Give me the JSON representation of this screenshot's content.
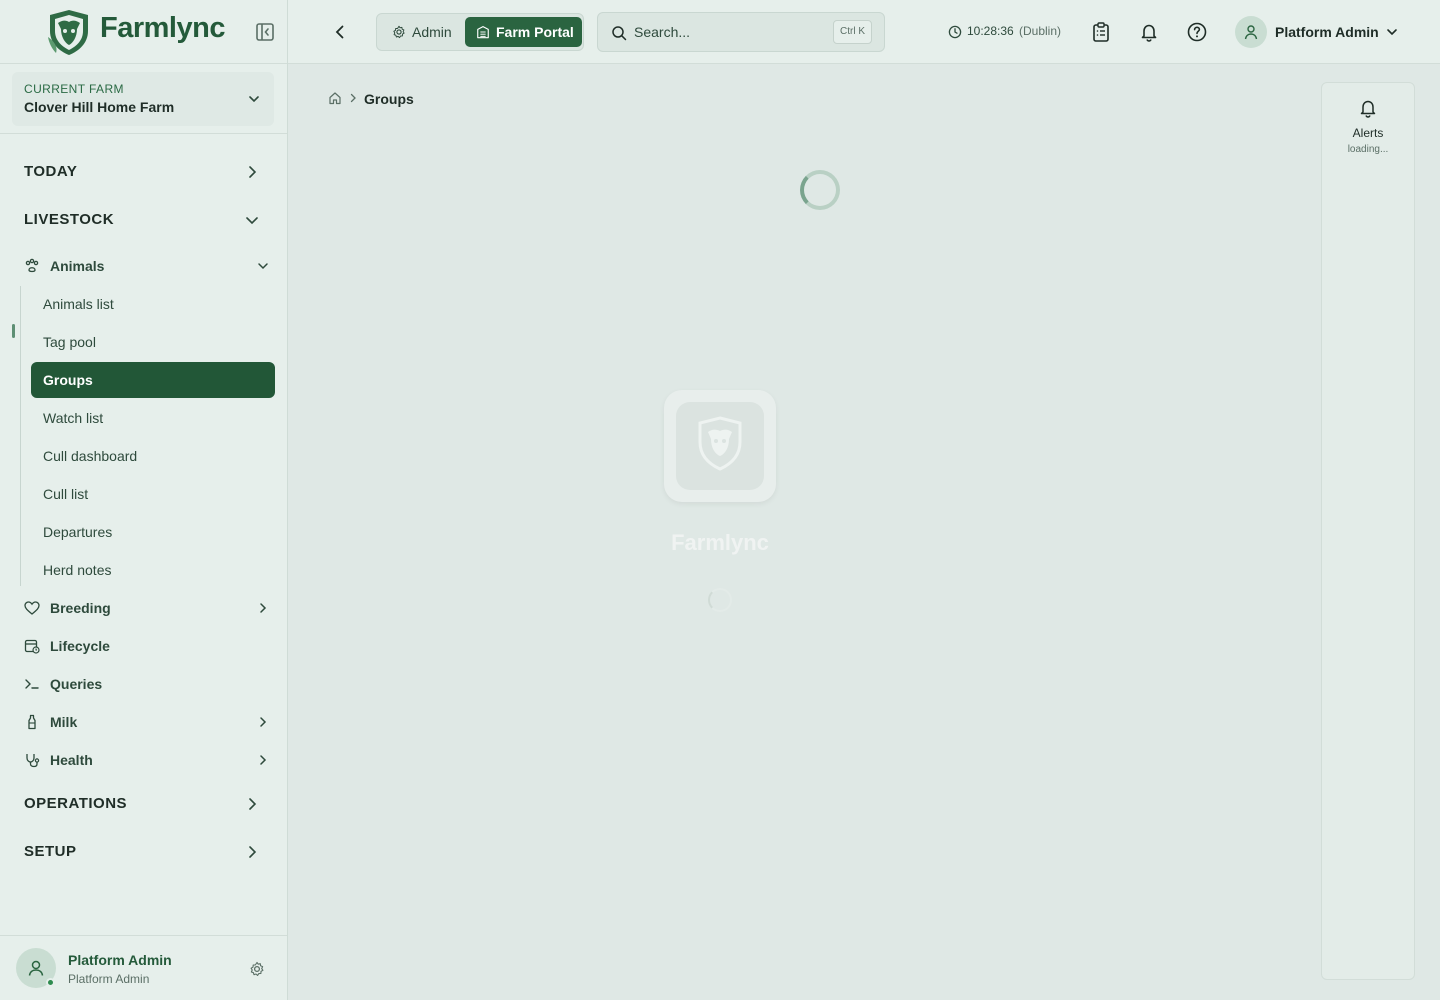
{
  "brand": {
    "name": "Farmlync"
  },
  "farm": {
    "caption": "CURRENT FARM",
    "name": "Clover Hill Home Farm"
  },
  "sidebar": {
    "sections": {
      "today": "TODAY",
      "livestock": "LIVESTOCK",
      "operations": "OPERATIONS",
      "setup": "SETUP"
    },
    "animals": {
      "label": "Animals",
      "items": [
        "Animals list",
        "Tag pool",
        "Groups",
        "Watch list",
        "Cull dashboard",
        "Cull list",
        "Departures",
        "Herd notes"
      ],
      "active": "Groups"
    },
    "modules": [
      "Breeding",
      "Lifecycle",
      "Queries",
      "Milk",
      "Health"
    ]
  },
  "profile": {
    "name": "Platform Admin",
    "role": "Platform Admin"
  },
  "topbar": {
    "admin_label": "Admin",
    "portal_label": "Farm Portal",
    "search_placeholder": "Search...",
    "search_shortcut": "Ctrl K",
    "clock_time": "10:28:36",
    "clock_zone": "(Dublin)",
    "user_name": "Platform Admin"
  },
  "breadcrumb": {
    "current": "Groups"
  },
  "splash": {
    "name": "Farmlync"
  },
  "alerts": {
    "label": "Alerts",
    "status": "loading..."
  },
  "colors": {
    "brand": "#245a3a",
    "active": "#225737",
    "background": "#dfe8e5"
  },
  "icons": [
    "farmlync-logo",
    "collapse-sidebar-icon",
    "chevron-down-icon",
    "chevron-right-icon",
    "paw-icon",
    "heart-icon",
    "calendar-icon",
    "terminal-icon",
    "bottle-icon",
    "stethoscope-icon",
    "gear-icon",
    "search-icon",
    "clock-icon",
    "clipboard-icon",
    "bell-icon",
    "help-icon",
    "user-icon",
    "home-icon"
  ]
}
